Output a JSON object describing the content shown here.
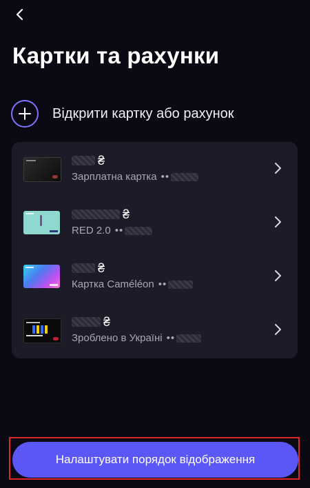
{
  "header": {
    "back_icon": "chevron-left-icon",
    "title": "Картки та рахунки"
  },
  "open_action": {
    "icon": "plus-icon",
    "label": "Відкрити картку або рахунок"
  },
  "cards": [
    {
      "currency": "₴",
      "name": "Зарплатна картка",
      "masked": "••",
      "thumb": "black-card"
    },
    {
      "currency": "₴",
      "name": "RED 2.0",
      "masked": "••",
      "thumb": "mint-card"
    },
    {
      "currency": "₴",
      "name": "Картка Caméléon",
      "masked": "••",
      "thumb": "gradient-card"
    },
    {
      "currency": "₴",
      "name": "Зроблено в Україні",
      "masked": "••",
      "thumb": "ukraine-card"
    }
  ],
  "footer": {
    "button_label": "Налаштувати порядок відображення"
  },
  "colors": {
    "background": "#0b0a14",
    "panel": "#1c1b27",
    "accent": "#5b57f7",
    "highlight": "#e0262d"
  }
}
